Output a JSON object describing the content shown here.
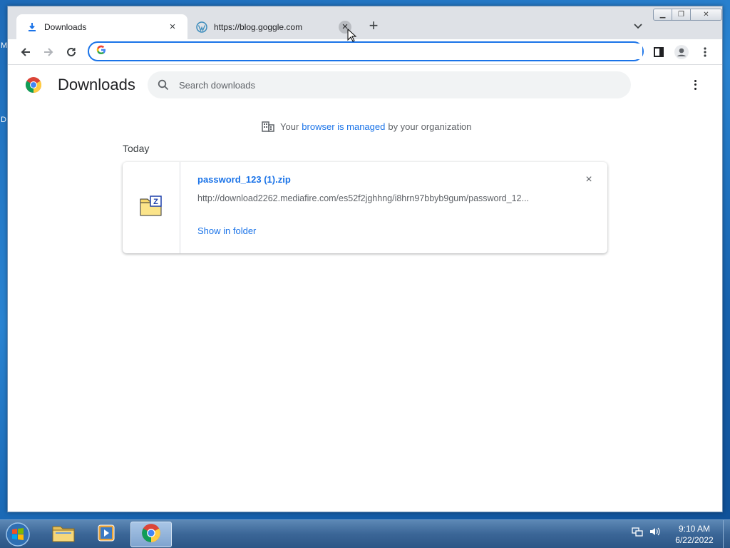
{
  "desktop": {
    "frag_top": "M",
    "frag_mid": "D"
  },
  "tabs": [
    {
      "title": "Downloads",
      "close": "×"
    },
    {
      "title": "https://blog.goggle.com",
      "close": "×"
    }
  ],
  "new_tab": "+",
  "window_controls": {
    "minimize": "▁",
    "maximize": "❐",
    "close": "✕"
  },
  "omnibox": {
    "value": ""
  },
  "page": {
    "title": "Downloads",
    "search_placeholder": "Search downloads",
    "managed_prefix": "Your",
    "managed_link": "browser is managed",
    "managed_suffix": "by your organization",
    "day_label": "Today"
  },
  "download": {
    "filename": "password_123 (1).zip",
    "url": "http://download2262.mediafire.com/es52f2jghhng/i8hrn97bbyb9gum/password_12...",
    "show_in_folder": "Show in folder",
    "remove": "×"
  },
  "taskbar": {
    "time": "9:10 AM",
    "date": "6/22/2022"
  },
  "colors": {
    "accent": "#1a73e8",
    "tabstrip": "#dee1e6"
  }
}
